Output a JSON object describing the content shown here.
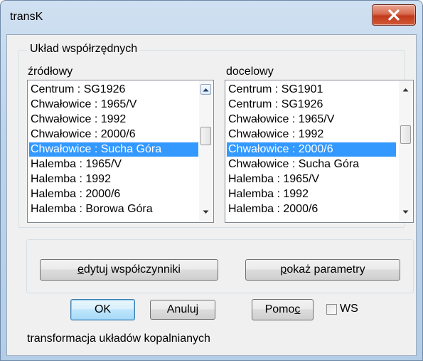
{
  "window": {
    "title": "transK"
  },
  "group": {
    "title": "Układ współrzędnych"
  },
  "source": {
    "label": "źródłowy",
    "items": [
      "Centrum : SG1926",
      "Chwałowice : 1965/V",
      "Chwałowice : 1992",
      "Chwałowice : 2000/6",
      "Chwałowice : Sucha Góra",
      "Halemba : 1965/V",
      "Halemba : 1992",
      "Halemba : 2000/6",
      "Halemba : Borowa Góra"
    ],
    "selected": "Chwałowice : Sucha Góra"
  },
  "target": {
    "label": "docelowy",
    "items": [
      "Centrum : SG1901",
      "Centrum : SG1926",
      "Chwałowice : 1965/V",
      "Chwałowice : 1992",
      "Chwałowice : 2000/6",
      "Chwałowice : Sucha Góra",
      "Halemba : 1965/V",
      "Halemba : 1992",
      "Halemba : 2000/6"
    ],
    "selected": "Chwałowice : 2000/6"
  },
  "buttons": {
    "edit_prefix": "",
    "edit_mnemonic": "e",
    "edit_rest": "dytuj współczynniki",
    "params_prefix": "",
    "params_mnemonic": "p",
    "params_rest": "okaż parametry",
    "ok": "OK",
    "cancel": "Anuluj",
    "help_prefix": "Pomo",
    "help_mnemonic": "c",
    "ws_label": "WS"
  },
  "status": "transformacja układów kopalnianych"
}
